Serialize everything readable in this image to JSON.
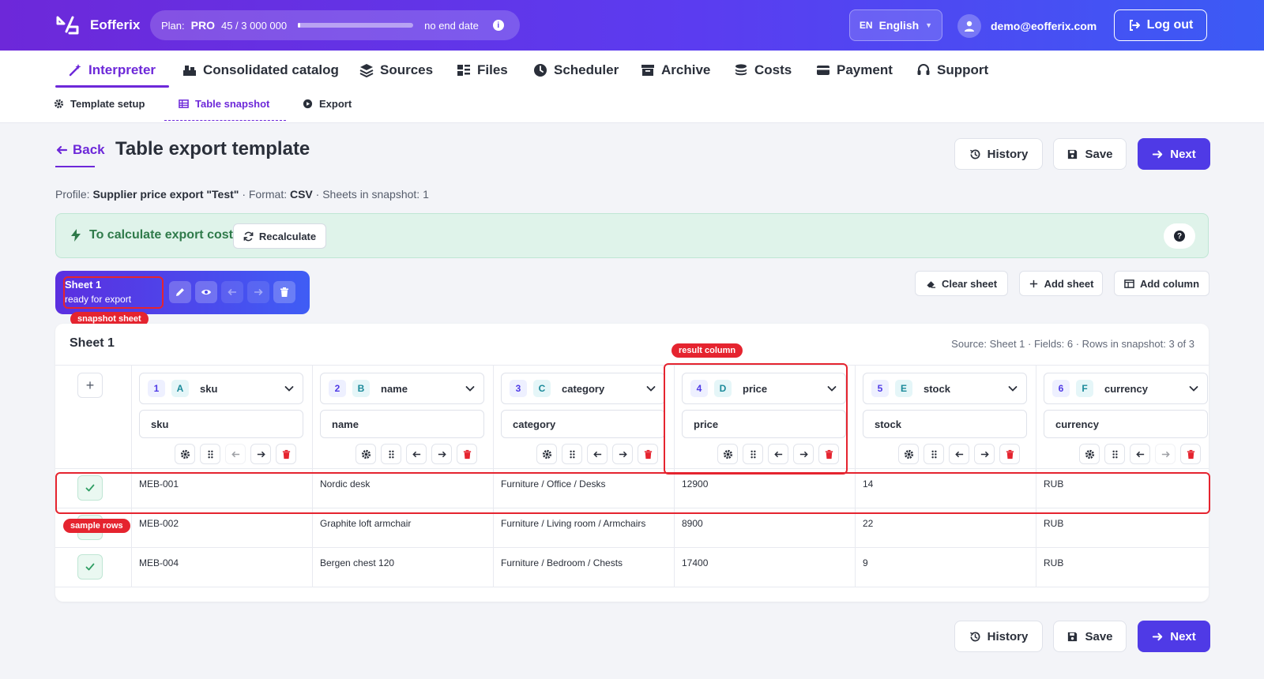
{
  "app": {
    "name": "Eofferix"
  },
  "plan": {
    "label": "Plan:",
    "tier": "PRO",
    "usage": "45  /  3 000 000",
    "usage_fraction": 1.5e-05,
    "end": "no end date"
  },
  "lang": {
    "code": "EN",
    "label": "English"
  },
  "user": {
    "email": "demo@eofferix.com"
  },
  "logout": {
    "label": "Log out"
  },
  "nav": {
    "items": [
      {
        "label": "Interpreter"
      },
      {
        "label": "Consolidated catalog"
      },
      {
        "label": "Sources"
      },
      {
        "label": "Files"
      },
      {
        "label": "Scheduler"
      },
      {
        "label": "Archive"
      },
      {
        "label": "Costs"
      },
      {
        "label": "Payment"
      },
      {
        "label": "Support"
      }
    ]
  },
  "subnav": {
    "items": [
      {
        "label": "Template setup"
      },
      {
        "label": "Table snapshot"
      },
      {
        "label": "Export"
      }
    ]
  },
  "page": {
    "back": "Back",
    "title": "Table export template",
    "profile_prefix": "Profile:",
    "profile_name": "Supplier price export \"Test\"",
    "format_prefix": "· Format:",
    "format": "CSV",
    "sheets_info": "· Sheets in snapshot: 1"
  },
  "actions": {
    "history": "History",
    "save": "Save",
    "next": "Next"
  },
  "banner": {
    "text": "To calculate export cost",
    "recalc": "Recalculate",
    "help": "?"
  },
  "sheet_tab": {
    "name": "Sheet 1",
    "status": "ready for export"
  },
  "sheet_actions": {
    "clear": "Clear sheet",
    "add_sheet": "Add sheet",
    "add_column": "Add column"
  },
  "annotations": {
    "snapshot_sheet": "snapshot sheet",
    "result_column": "result column",
    "sample_rows": "sample rows"
  },
  "table": {
    "sheet_name": "Sheet 1",
    "meta": "Source: Sheet 1 · Fields: 6 · Rows in snapshot: 3 of 3",
    "add": "+",
    "columns": [
      {
        "num": "1",
        "letter": "A",
        "field": "sku",
        "name": "sku"
      },
      {
        "num": "2",
        "letter": "B",
        "field": "name",
        "name": "name"
      },
      {
        "num": "3",
        "letter": "C",
        "field": "category",
        "name": "category"
      },
      {
        "num": "4",
        "letter": "D",
        "field": "price",
        "name": "price"
      },
      {
        "num": "5",
        "letter": "E",
        "field": "stock",
        "name": "stock"
      },
      {
        "num": "6",
        "letter": "F",
        "field": "currency",
        "name": "currency"
      }
    ],
    "rows": [
      [
        "MEB-001",
        "Nordic desk",
        "Furniture / Office / Desks",
        "12900",
        "14",
        "RUB"
      ],
      [
        "MEB-002",
        "Graphite loft armchair",
        "Furniture / Living room / Armchairs",
        "8900",
        "22",
        "RUB"
      ],
      [
        "MEB-004",
        "Bergen chest 120",
        "Furniture / Bedroom / Chests",
        "17400",
        "9",
        "RUB"
      ]
    ]
  },
  "colors": {
    "brand": "#6d28d9",
    "primary": "#4f3ae6",
    "success": "#2f7a4a",
    "danger": "#e5242f"
  }
}
